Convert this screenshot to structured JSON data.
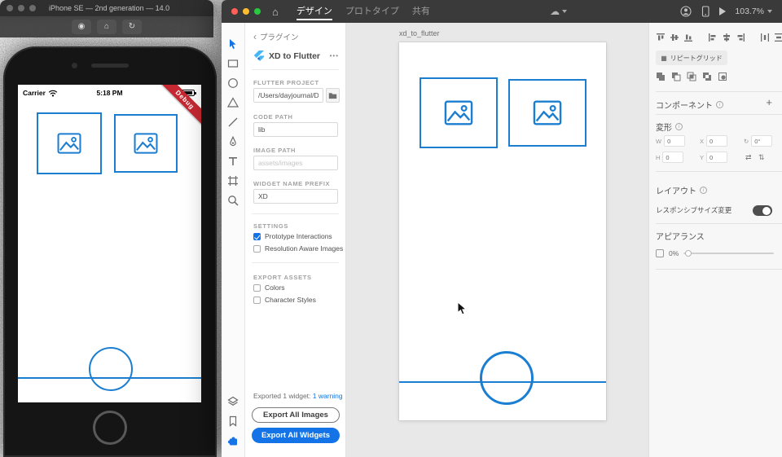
{
  "icons": {
    "back_chevron": "‹",
    "menu_dots": "•••",
    "home": "⌂",
    "cloud": "☁",
    "grid": "▦",
    "plus": "+",
    "info": "i",
    "rotate": "↻",
    "flips": "⇄ ⇅",
    "camera_button": "◉",
    "home_button": "⌂",
    "rotate_button": "↻"
  },
  "simulator": {
    "window_title": "iPhone SE — 2nd generation — 14.0",
    "statusbar": {
      "carrier": "Carrier",
      "time": "5:18 PM"
    },
    "debug_banner": "Debug"
  },
  "xd": {
    "titlebar": {
      "tabs": [
        {
          "label": "デザイン"
        },
        {
          "label": "プロトタイプ"
        },
        {
          "label": "共有"
        }
      ],
      "zoom_level": "103.7%"
    },
    "plugin": {
      "back_label": "プラグイン",
      "name": "XD to Flutter",
      "flutter_project_label": "FLUTTER PROJECT",
      "flutter_project_value": "/Users/dayjournal/Dc",
      "code_path_label": "CODE PATH",
      "code_path_value": "lib",
      "image_path_label": "IMAGE PATH",
      "image_path_placeholder": "assets/images",
      "widget_prefix_label": "WIDGET NAME PREFIX",
      "widget_prefix_value": "XD",
      "settings_title": "SETTINGS",
      "settings_options": [
        {
          "label": "Prototype Interactions",
          "checked": true
        },
        {
          "label": "Resolution Aware Images",
          "checked": false
        }
      ],
      "export_assets_title": "EXPORT ASSETS",
      "export_assets_options": [
        {
          "label": "Colors",
          "checked": false
        },
        {
          "label": "Character Styles",
          "checked": false
        }
      ],
      "status_text": "Exported 1 widget:",
      "status_link": "1 warning",
      "export_images_label": "Export All Images",
      "export_widgets_label": "Export All Widgets"
    },
    "canvas": {
      "artboard_label": "xd_to_flutter"
    },
    "props": {
      "repeat_grid_label": "リピートグリッド",
      "component_label": "コンポーネント",
      "transform_label": "変形",
      "w_label": "W",
      "w_value": "0",
      "h_label": "H",
      "h_value": "0",
      "x_label": "X",
      "x_value": "0",
      "y_label": "Y",
      "y_value": "0",
      "rotation_value": "0°",
      "layout_label": "レイアウト",
      "responsive_label": "レスポンシブサイズ変更",
      "responsive_on": true,
      "appearance_label": "アピアランス",
      "opacity_value": "0%"
    }
  }
}
